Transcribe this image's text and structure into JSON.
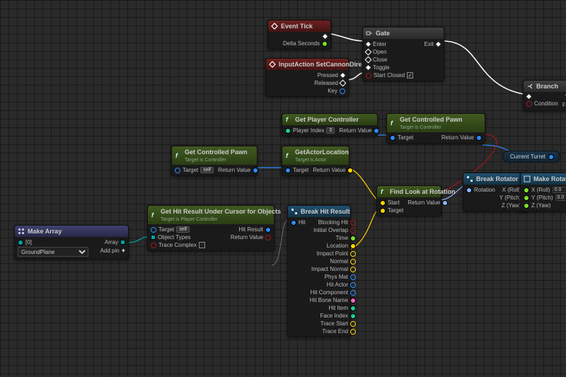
{
  "vars": {
    "currentTurret": "Current Turret"
  },
  "pins": {
    "enter": "Enter",
    "open": "Open",
    "close": "Close",
    "toggle": "Toggle",
    "startClosed": "Start Closed",
    "exit": "Exit",
    "condition": "Condition",
    "true": "True",
    "false": "False",
    "target": "Target",
    "targetSelf": "self",
    "playerIndex": "Player Index",
    "playerIndexVal": "0",
    "returnValue": "Return Value",
    "deltaSeconds": "Delta Seconds",
    "pressed": "Pressed",
    "released": "Released",
    "key": "Key",
    "objectTypes": "Object Types",
    "traceComplex": "Trace Complex",
    "hitResult": "Hit Result",
    "hit": "Hit",
    "blockingHit": "Blocking Hit",
    "initialOverlap": "Initial Overlap",
    "time": "Time",
    "location": "Location",
    "impactPoint": "Impact Point",
    "normal": "Normal",
    "impactNormal": "Impact Normal",
    "physMat": "Phys Mat",
    "hitActor": "Hit Actor",
    "hitComponent": "Hit Component",
    "hitBoneName": "Hit Bone Name",
    "hitItem": "Hit Item",
    "faceIndex": "Face Index",
    "traceStart": "Trace Start",
    "traceEnd": "Trace End",
    "start": "Start",
    "targetPin": "Target",
    "rotation": "Rotation",
    "xroll": "X (Roll)",
    "ypitch": "Y (Pitch)",
    "zyaw": "Z (Yaw)",
    "rollVal": "0.0",
    "pitchVal": "0.0",
    "array": "Array",
    "addPin": "Add pin",
    "arrIndex0": "[0]",
    "groundPlane": "GroundPlane"
  },
  "nodes": {
    "eventTick": {
      "title": "Event Tick"
    },
    "inputAction": {
      "title": "InputAction SetCannonDirection"
    },
    "gate": {
      "title": "Gate"
    },
    "branch": {
      "title": "Branch"
    },
    "getPlayerController": {
      "title": "Get Player Controller"
    },
    "getControlledPawnTop": {
      "title": "Get Controlled Pawn",
      "subtitle": "Target is Controller"
    },
    "getControlledPawnLeft": {
      "title": "Get Controlled Pawn",
      "subtitle": "Target is Controller"
    },
    "getActorLocation": {
      "title": "GetActorLocation",
      "subtitle": "Target is Actor"
    },
    "getHitCursor": {
      "title": "Get Hit Result Under Cursor for Objects",
      "subtitle": "Target is Player Controller"
    },
    "breakHit": {
      "title": "Break Hit Result"
    },
    "findLookAt": {
      "title": "Find Look at Rotation"
    },
    "breakRotator": {
      "title": "Break Rotator"
    },
    "makeRotator": {
      "title": "Make Rotator"
    },
    "makeArray": {
      "title": "Make Array"
    }
  }
}
